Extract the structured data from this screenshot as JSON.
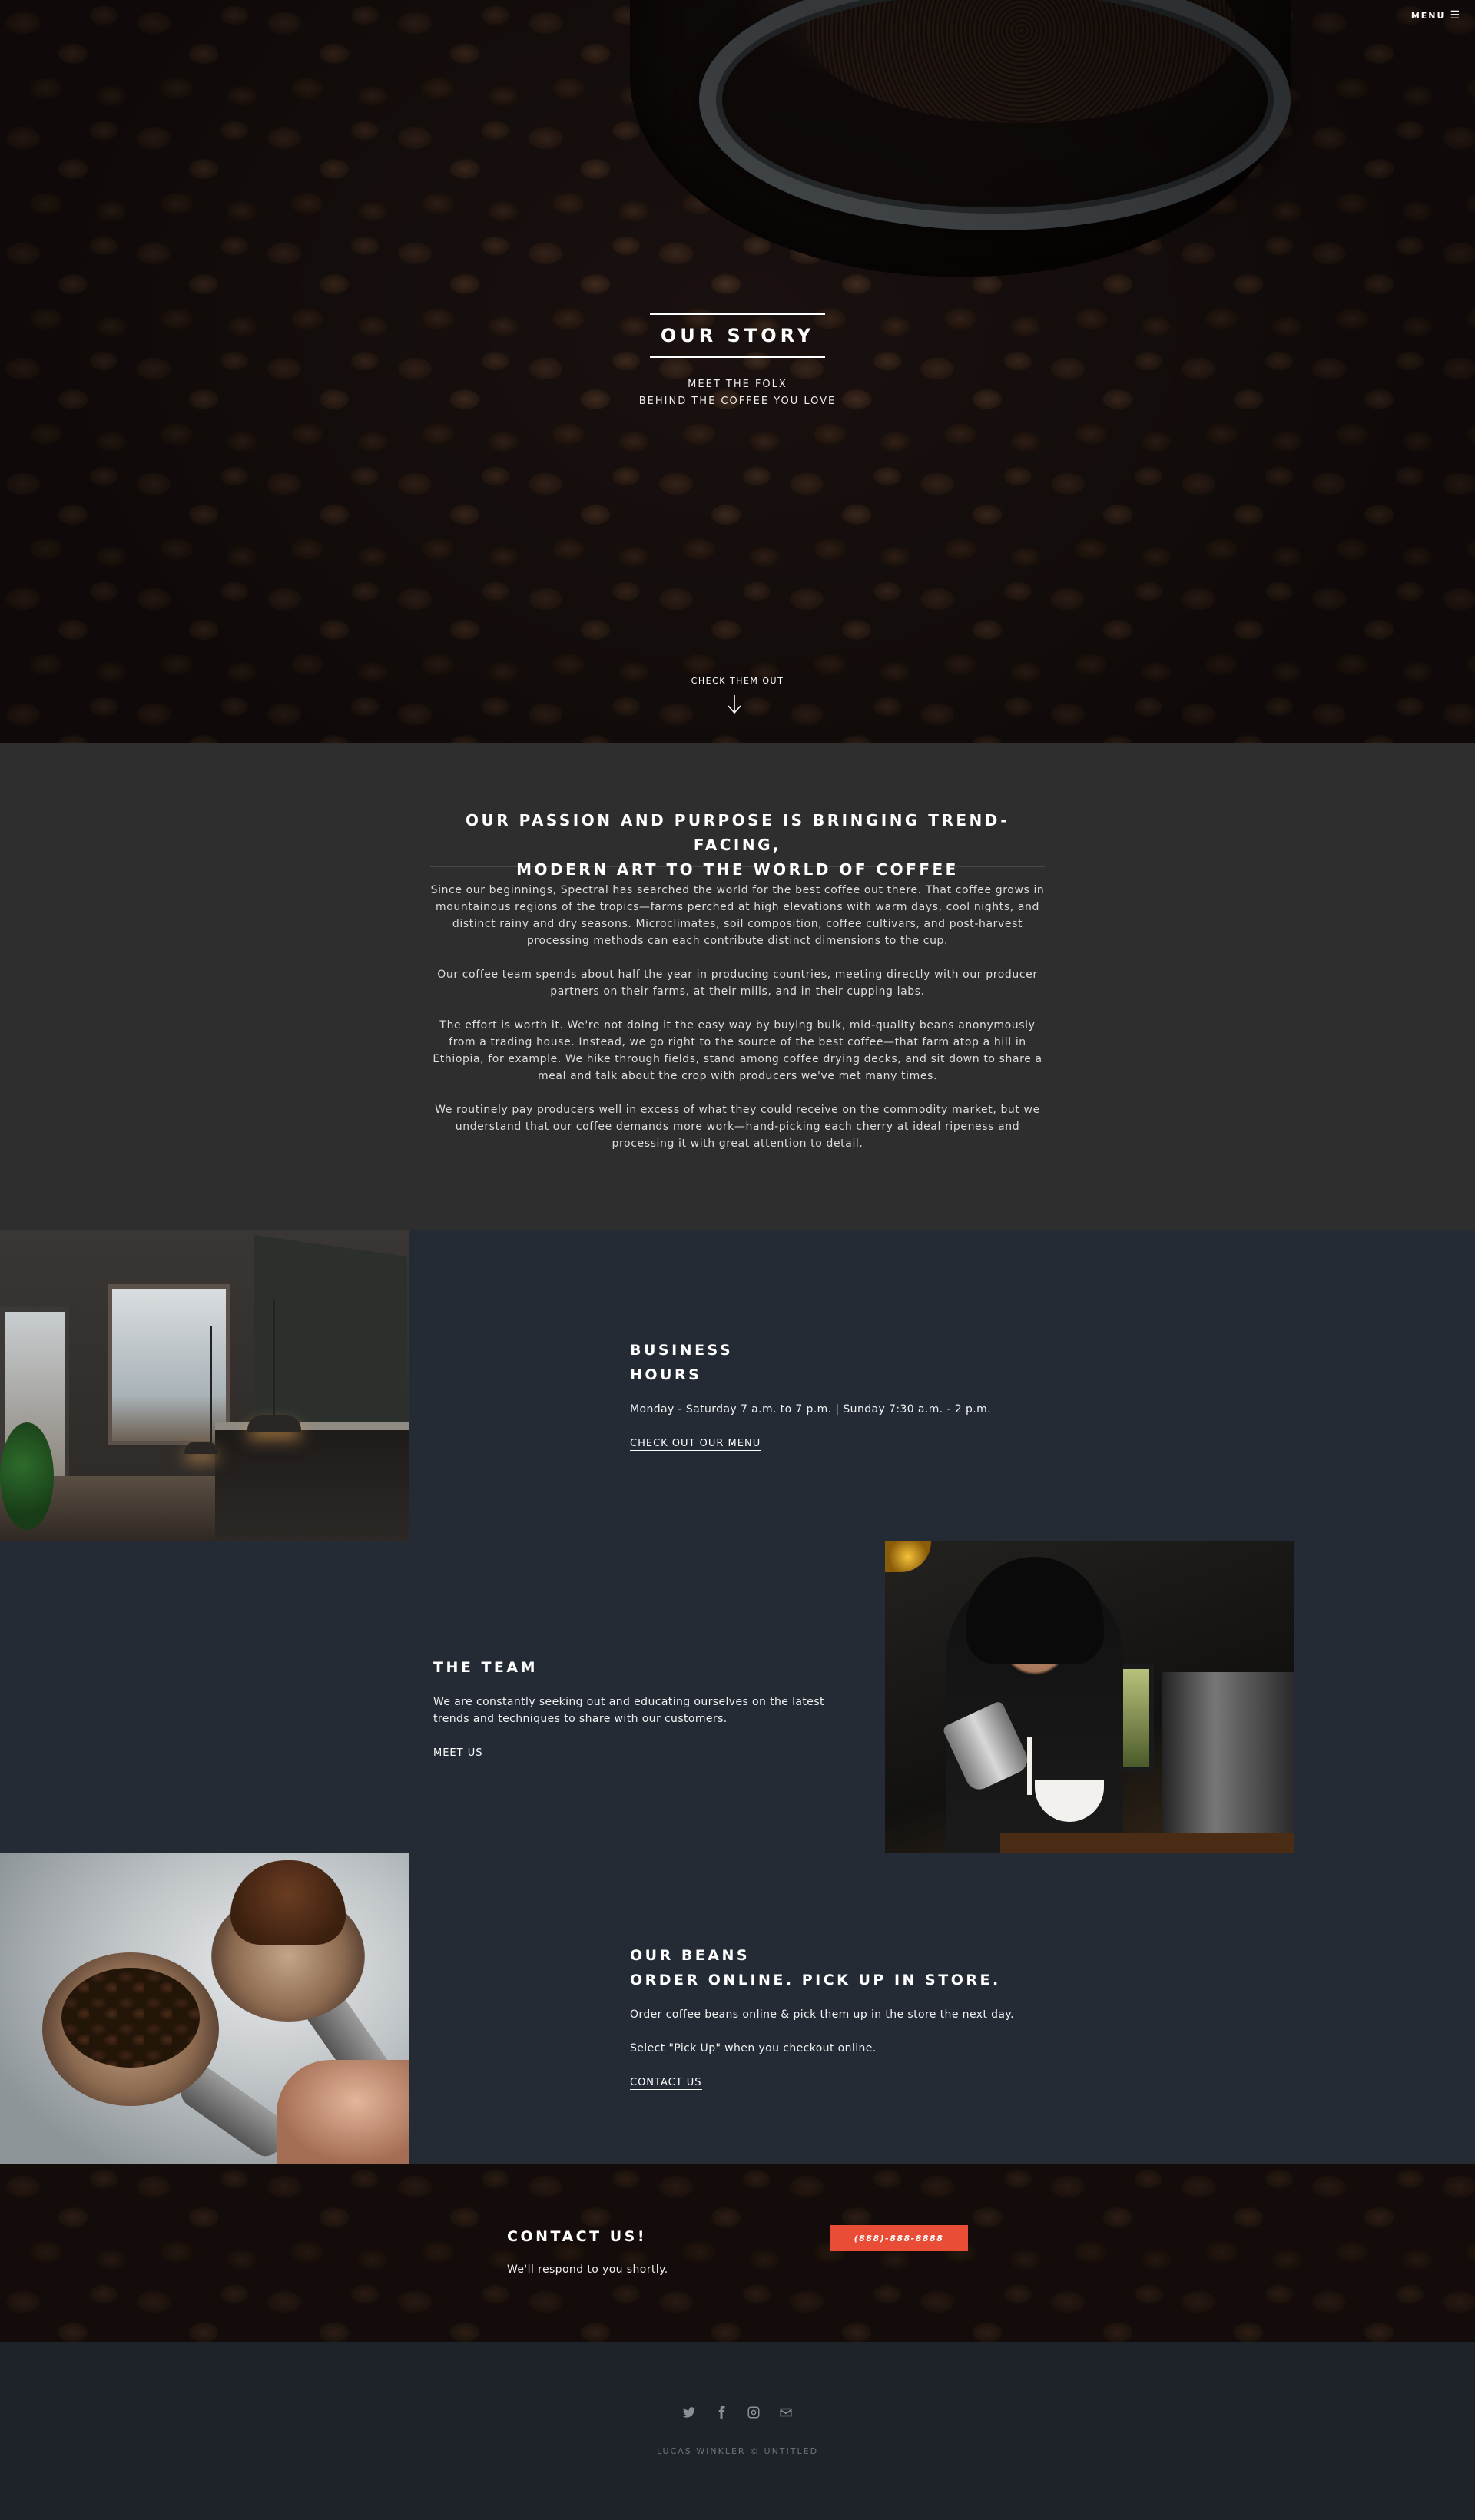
{
  "header": {
    "menu_label": "MENU",
    "menu_icon": "hamburger-icon"
  },
  "hero": {
    "title": "OUR STORY",
    "subtitle_line1": "MEET THE FOLX",
    "subtitle_line2": "BEHIND THE COFFEE YOU LOVE",
    "scroll_label": "CHECK THEM OUT",
    "scroll_icon": "arrow-down-icon"
  },
  "intro": {
    "heading_line1": "OUR PASSION AND PURPOSE IS BRINGING TREND-FACING,",
    "heading_line2": "MODERN ART TO THE WORLD OF COFFEE",
    "paragraphs": [
      "Since our beginnings, Spectral has searched the world for the best coffee out there. That coffee grows in mountainous regions of the tropics—farms perched at high elevations with warm days, cool nights, and distinct rainy and dry seasons. Microclimates, soil composition, coffee cultivars, and post-harvest processing methods can each contribute distinct dimensions to the cup.",
      "Our coffee team spends about half the year in producing countries, meeting directly with our producer partners on their farms, at their mills, and in their cupping labs.",
      "The effort is worth it. We're not doing it the easy way by buying bulk, mid-quality beans anonymously from a trading house. Instead, we go right to the source of the best coffee—that farm atop a hill in Ethiopia, for example. We hike through fields, stand among coffee drying decks, and sit down to share a meal and talk about the crop with producers we've met many times.",
      "We routinely pay producers well in excess of what they could receive on the commodity market, but we understand that our coffee demands more work—hand-picking each cherry at ideal ripeness and processing it with great attention to detail."
    ]
  },
  "spotlights": [
    {
      "title_line1": "BUSINESS",
      "title_line2": "HOURS",
      "text1": "Monday - Saturday 7 a.m. to 7 p.m. | Sunday 7:30 a.m. - 2 p.m.",
      "link": "CHECK OUT OUR MENU"
    },
    {
      "title_line1": "THE TEAM",
      "text1": "We are constantly seeking out and educating ourselves on the latest trends and techniques to share with our customers.",
      "link": "MEET US"
    },
    {
      "title_line1": "OUR BEANS",
      "title_line2": "ORDER ONLINE. PICK UP IN STORE.",
      "text1": "Order coffee beans online & pick them up in the store the next day.",
      "text2": "Select \"Pick Up\" when you checkout online.",
      "link": "CONTACT US"
    }
  ],
  "cta": {
    "title": "CONTACT US!",
    "text": "We'll respond to you shortly.",
    "button": "(888)-888-8888",
    "button_color": "#e94d35"
  },
  "footer": {
    "social_icons": [
      "twitter-icon",
      "facebook-icon",
      "instagram-icon",
      "email-icon"
    ],
    "copyright": "LUCAS WINKLER © UNTITLED"
  },
  "colors": {
    "intro_bg": "#2e2e2e",
    "spotlight_bg": "#252b35",
    "footer_bg": "#1e2329"
  }
}
